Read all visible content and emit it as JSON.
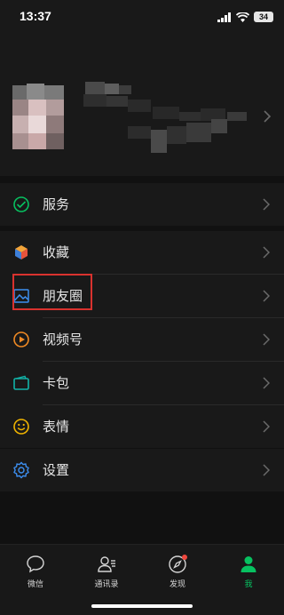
{
  "status_bar": {
    "time": "13:37",
    "battery": "34"
  },
  "menu": {
    "services": "服务",
    "favorites": "收藏",
    "moments": "朋友圈",
    "channels": "视频号",
    "cards": "卡包",
    "stickers": "表情",
    "settings": "设置"
  },
  "tabs": {
    "chats": "微信",
    "contacts": "通讯录",
    "discover": "发现",
    "me": "我"
  },
  "colors": {
    "accent": "#07c160",
    "highlight": "#d9322e",
    "background": "#111111",
    "panel": "#191919"
  }
}
